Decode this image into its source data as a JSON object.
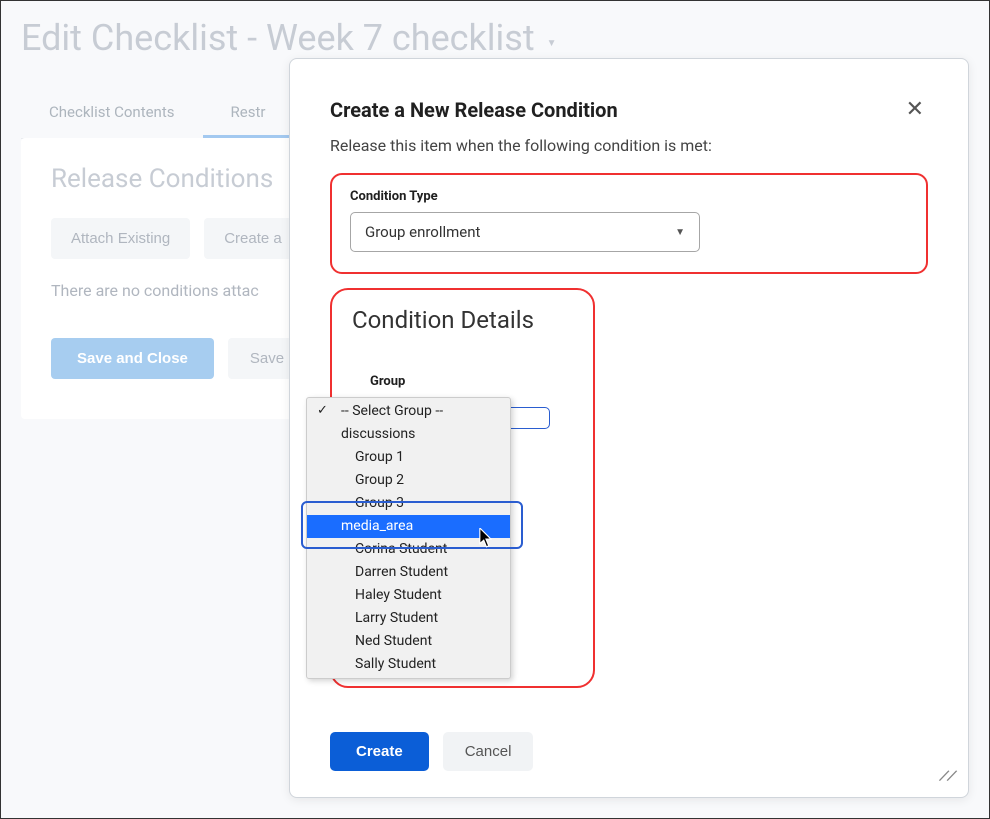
{
  "page": {
    "title": "Edit Checklist - Week 7 checklist"
  },
  "tabs": {
    "contents": "Checklist Contents",
    "restrictions_partial": "Restr"
  },
  "releaseConditions": {
    "heading": "Release Conditions",
    "attachExisting": "Attach Existing",
    "createPartial": "Create a",
    "infoText": "There are no conditions attac"
  },
  "actions": {
    "saveAndClose": "Save and Close",
    "save": "Save"
  },
  "modal": {
    "title": "Create a New Release Condition",
    "subtitle": "Release this item when the following condition is met:",
    "conditionTypeLabel": "Condition Type",
    "conditionTypeValue": "Group enrollment",
    "detailsHeading": "Condition Details",
    "groupLabel": "Group",
    "createBtn": "Create",
    "cancelBtn": "Cancel"
  },
  "dropdown": {
    "options": [
      {
        "label": "-- Select Group --",
        "indent": 0,
        "selected": true
      },
      {
        "label": "discussions",
        "indent": 1
      },
      {
        "label": "Group 1",
        "indent": 2
      },
      {
        "label": "Group 2",
        "indent": 2
      },
      {
        "label": "Group 3",
        "indent": 2
      },
      {
        "label": "media_area",
        "indent": 1,
        "highlighted": true
      },
      {
        "label": "Corina Student",
        "indent": 2
      },
      {
        "label": "Darren Student",
        "indent": 2
      },
      {
        "label": "Haley Student",
        "indent": 2
      },
      {
        "label": "Larry Student",
        "indent": 2
      },
      {
        "label": "Ned Student",
        "indent": 2
      },
      {
        "label": "Sally Student",
        "indent": 2
      }
    ]
  }
}
